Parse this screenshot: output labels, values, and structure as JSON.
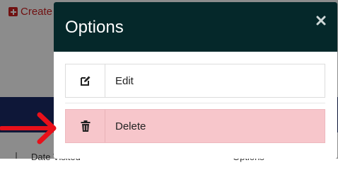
{
  "background": {
    "create_label": "Create",
    "table_headers": {
      "date_visited": "Date Visited",
      "options": "Options"
    }
  },
  "modal": {
    "title": "Options",
    "options": [
      {
        "label": "Edit",
        "icon": "edit-icon"
      },
      {
        "label": "Delete",
        "icon": "trash-icon",
        "highlight_color": "#f7c6cb"
      }
    ]
  },
  "colors": {
    "header_bg": "#05282a",
    "accent_red": "#cc1f1f",
    "arrow_red": "#e8101a"
  }
}
